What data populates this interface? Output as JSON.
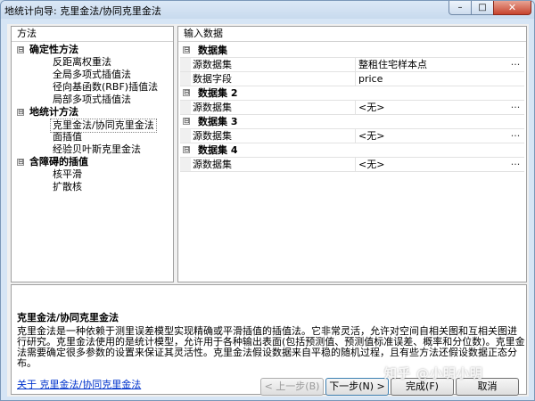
{
  "window": {
    "title": "地统计向导: 克里金法/协同克里金法",
    "controls": {
      "minimize": "–",
      "maximize": "□",
      "close": "✕"
    }
  },
  "left_panel": {
    "header": "方法",
    "tree": [
      {
        "label": "确定性方法",
        "group": true,
        "expander": "⊟"
      },
      {
        "label": "反距离权重法",
        "group": false
      },
      {
        "label": "全局多项式插值法",
        "group": false
      },
      {
        "label": "径向基函数(RBF)插值法",
        "group": false
      },
      {
        "label": "局部多项式插值法",
        "group": false
      },
      {
        "label": "地统计方法",
        "group": true,
        "expander": "⊟"
      },
      {
        "label": "克里金法/协同克里金法",
        "group": false,
        "selected": true
      },
      {
        "label": "面插值",
        "group": false
      },
      {
        "label": "经验贝叶斯克里金法",
        "group": false
      },
      {
        "label": "含障碍的插值",
        "group": true,
        "expander": "⊟"
      },
      {
        "label": "核平滑",
        "group": false
      },
      {
        "label": "扩散核",
        "group": false
      }
    ]
  },
  "right_panel": {
    "header": "输入数据",
    "categories": [
      {
        "title": "数据集",
        "rows": [
          {
            "name": "源数据集",
            "value": "整租住宅样本点",
            "ellipsis": "..."
          },
          {
            "name": "数据字段",
            "value": "price",
            "ellipsis": ""
          }
        ]
      },
      {
        "title": "数据集 2",
        "rows": [
          {
            "name": "源数据集",
            "value": "<无>",
            "ellipsis": "..."
          }
        ]
      },
      {
        "title": "数据集 3",
        "rows": [
          {
            "name": "源数据集",
            "value": "<无>",
            "ellipsis": "..."
          }
        ]
      },
      {
        "title": "数据集 4",
        "rows": [
          {
            "name": "源数据集",
            "value": "<无>",
            "ellipsis": "..."
          }
        ]
      }
    ]
  },
  "description": {
    "title": "克里金法/协同克里金法",
    "body": "克里金法是一种依赖于测里误差模型实现精确或平滑插值的插值法。它非常灵活，允许对空间自相关图和互相关图进行研究。克里金法使用的是统计模型，允许用于各种输出表面(包括预测值、预测值标准误差、概率和分位数)。克里金法需要确定很多参数的设置来保证其灵活性。克里金法假设数据来自平稳的随机过程，且有些方法还假设数据正态分布。",
    "link": "关于 克里金法/协同克里金法"
  },
  "buttons": {
    "prev": "< 上一步(B)",
    "next": "下一步(N) >",
    "finish": "完成(F)",
    "cancel": "取消"
  },
  "watermark": "知乎 @小明小明"
}
